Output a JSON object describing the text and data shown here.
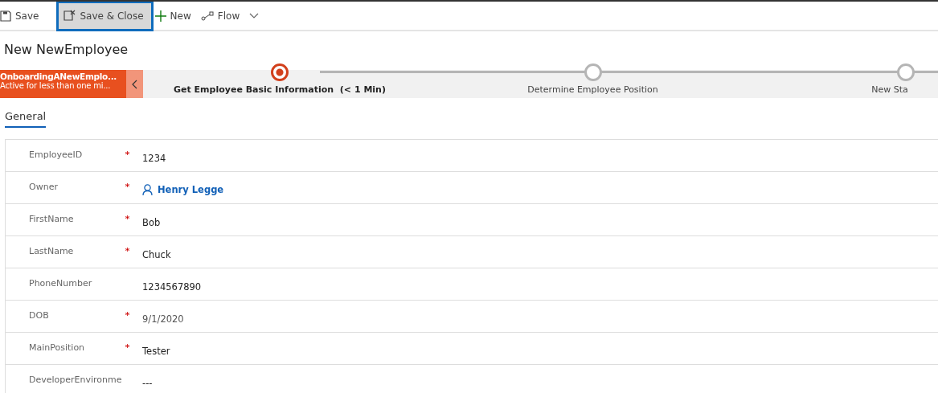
{
  "toolbar": [
    {
      "label": "Save",
      "kind": "save",
      "selected": false
    },
    {
      "label": "Save & Close",
      "kind": "save-close",
      "selected": true
    },
    {
      "label": "New",
      "kind": "new",
      "selected": false
    },
    {
      "label": "Flow",
      "kind": "flow",
      "selected": false
    }
  ],
  "title": "New NewEmployee",
  "process": {
    "name": "OnboardingANewEmplo...",
    "status": "Active for less than one mi...",
    "stages": [
      {
        "label": "Get Employee Basic Information",
        "duration": "(< 1 Min)",
        "selected": true
      },
      {
        "label": "Determine Employee Position",
        "selected": false
      },
      {
        "label": "New Sta",
        "selected": false
      }
    ]
  },
  "tabs": [
    {
      "label": "General",
      "selected": true
    }
  ],
  "fields": [
    {
      "label": "EmployeeID",
      "required": true,
      "kind": "text",
      "value": "1234"
    },
    {
      "label": "Owner",
      "required": true,
      "kind": "lookup",
      "value": "Henry Legge"
    },
    {
      "label": "FirstName",
      "required": true,
      "kind": "text",
      "value": "Bob"
    },
    {
      "label": "LastName",
      "required": true,
      "kind": "text",
      "value": "Chuck"
    },
    {
      "label": "PhoneNumber",
      "required": false,
      "kind": "text",
      "value": "1234567890"
    },
    {
      "label": "DOB",
      "required": true,
      "kind": "date",
      "value": "9/1/2020"
    },
    {
      "label": "MainPosition",
      "required": true,
      "kind": "text",
      "value": "Tester"
    },
    {
      "label": "DeveloperEnvironme",
      "required": false,
      "kind": "text",
      "value": "---"
    }
  ]
}
